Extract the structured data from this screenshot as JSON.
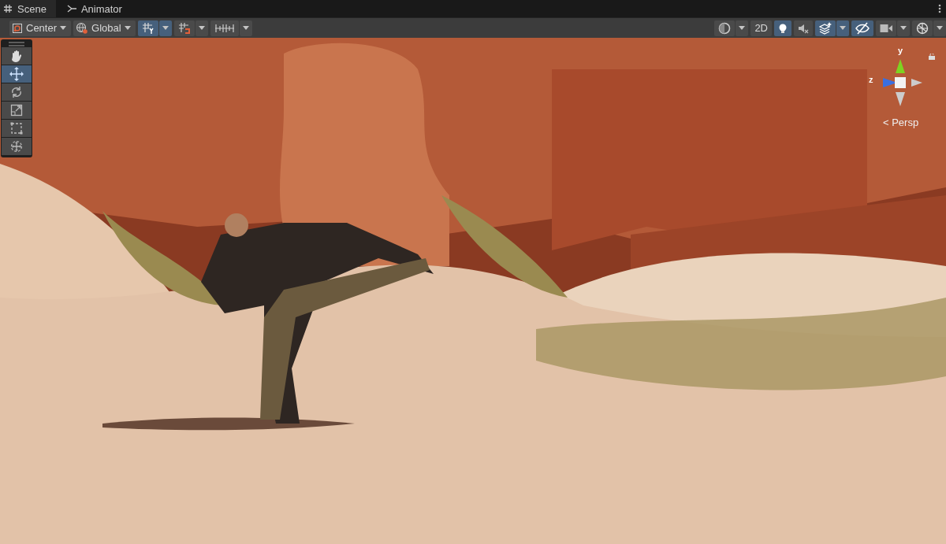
{
  "tabs": [
    {
      "label": "Scene",
      "kind": "scene",
      "selected": true
    },
    {
      "label": "Animator",
      "kind": "animator",
      "selected": false
    }
  ],
  "toolbar": {
    "left": [
      {
        "kind": "pivot",
        "label": "Center",
        "selected": false,
        "has_menu": true
      },
      {
        "kind": "space",
        "label": "Global",
        "selected": false,
        "has_menu": true
      },
      {
        "kind": "grid",
        "selected": true,
        "has_menu": true
      },
      {
        "kind": "snap",
        "selected": false,
        "has_menu": true
      },
      {
        "kind": "increment",
        "selected": false,
        "has_menu": true
      }
    ],
    "right": [
      {
        "kind": "shading",
        "selected": false,
        "has_menu": true
      },
      {
        "kind": "flat",
        "label": "2D",
        "selected": false,
        "has_menu": false
      },
      {
        "kind": "lighting",
        "selected": true,
        "has_menu": false
      },
      {
        "kind": "audio",
        "selected": false,
        "has_menu": false
      },
      {
        "kind": "effects",
        "selected": true,
        "has_menu": true
      },
      {
        "kind": "hidden",
        "selected": true,
        "has_menu": false
      },
      {
        "kind": "camera",
        "selected": false,
        "has_menu": true
      },
      {
        "kind": "gizmos",
        "selected": false,
        "has_menu": true
      }
    ]
  },
  "tools": [
    {
      "kind": "hand",
      "selected": false
    },
    {
      "kind": "move",
      "selected": true
    },
    {
      "kind": "rotate",
      "selected": false
    },
    {
      "kind": "scale",
      "selected": false
    },
    {
      "kind": "rect",
      "selected": false
    },
    {
      "kind": "transform",
      "selected": false
    }
  ],
  "gizmo": {
    "y_label": "y",
    "z_label": "z",
    "projection": "< Persp"
  }
}
